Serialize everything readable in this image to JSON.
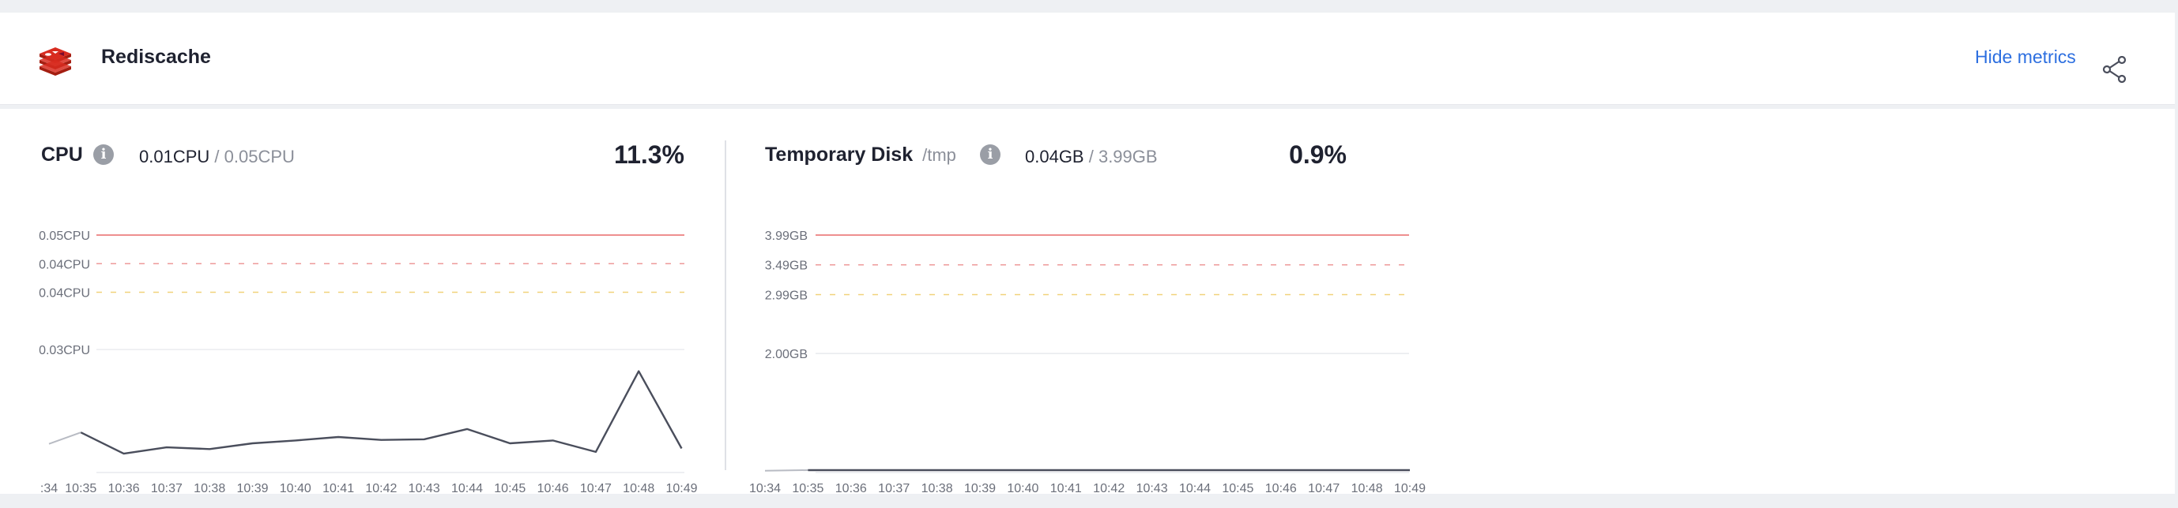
{
  "header": {
    "service_name": "Rediscache",
    "hide_metrics_label": "Hide metrics",
    "logo_icon": "redis-logo-icon",
    "share_icon": "share-icon"
  },
  "colors": {
    "limit_line": "#e86a6a",
    "warning_line_red": "#ee9a9a",
    "warning_line_yellow": "#f1d27a",
    "series_line": "#4a4e5c",
    "link": "#2d6fe0"
  },
  "cpu": {
    "title": "CPU",
    "used": "0.01CPU",
    "separator": " / ",
    "limit": "0.05CPU",
    "percent": "11.3%",
    "info_icon": "info-icon"
  },
  "disk": {
    "title": "Temporary Disk",
    "path": "/tmp",
    "used": "0.04GB",
    "separator": " / ",
    "limit": "3.99GB",
    "percent": "0.9%",
    "info_icon": "info-icon"
  },
  "chart_data": [
    {
      "type": "line",
      "name": "cpu",
      "x": [
        ":34",
        "10:35",
        "10:36",
        "10:37",
        "10:38",
        "10:39",
        "10:40",
        "10:41",
        "10:42",
        "10:43",
        "10:44",
        "10:45",
        "10:46",
        "10:47",
        "10:48",
        "10:49"
      ],
      "y_ticks": [
        {
          "label": "0.05CPU",
          "value": 0.05,
          "style": "limit"
        },
        {
          "label": "0.04CPU",
          "value": 0.045,
          "style": "warn-red"
        },
        {
          "label": "0.04CPU",
          "value": 0.04,
          "style": "warn-yellow"
        },
        {
          "label": "0.03CPU",
          "value": 0.03,
          "style": "grid"
        }
      ],
      "ylim": [
        0.0085,
        0.05
      ],
      "series": [
        {
          "values": [
            0.0135,
            0.0155,
            0.0118,
            0.0129,
            0.0126,
            0.0136,
            0.0141,
            0.0147,
            0.0142,
            0.0143,
            0.0161,
            0.0136,
            0.0141,
            0.0121,
            0.0262,
            0.0127
          ]
        }
      ],
      "grid": true
    },
    {
      "type": "line",
      "name": "disk",
      "x": [
        "10:34",
        "10:35",
        "10:36",
        "10:37",
        "10:38",
        "10:39",
        "10:40",
        "10:41",
        "10:42",
        "10:43",
        "10:44",
        "10:45",
        "10:46",
        "10:47",
        "10:48",
        "10:49"
      ],
      "y_ticks": [
        {
          "label": "3.99GB",
          "value": 3.99,
          "style": "limit"
        },
        {
          "label": "3.49GB",
          "value": 3.49,
          "style": "warn-red"
        },
        {
          "label": "2.99GB",
          "value": 2.99,
          "style": "warn-yellow"
        },
        {
          "label": "2.00GB",
          "value": 2.0,
          "style": "grid"
        }
      ],
      "ylim": [
        0.0,
        3.99
      ],
      "series": [
        {
          "values": [
            0.03,
            0.04,
            0.04,
            0.04,
            0.04,
            0.04,
            0.04,
            0.04,
            0.04,
            0.04,
            0.04,
            0.04,
            0.04,
            0.04,
            0.04,
            0.04
          ]
        }
      ],
      "grid": true
    }
  ]
}
